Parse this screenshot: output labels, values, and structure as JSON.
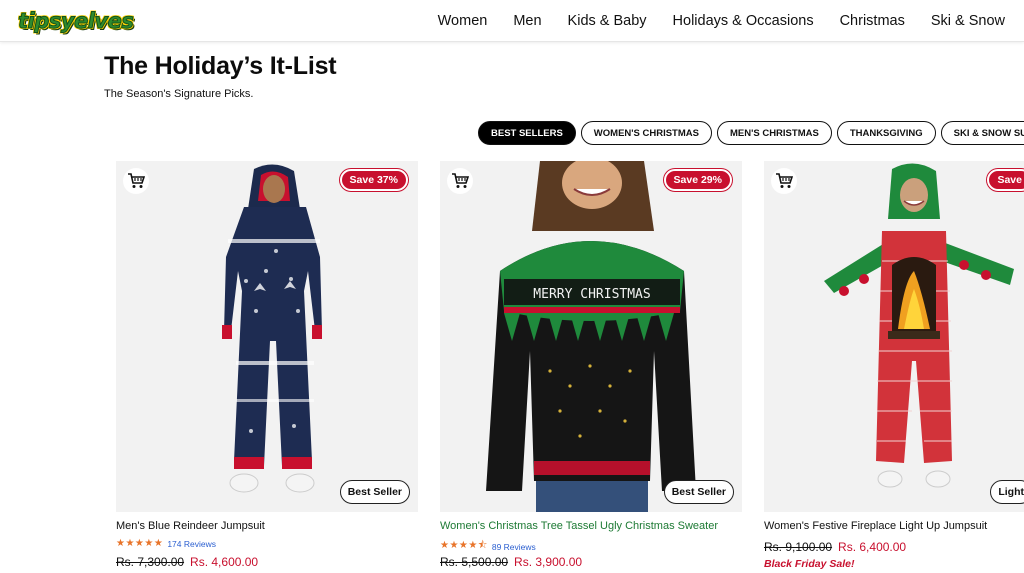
{
  "header": {
    "logo_text": "tipsyelves",
    "nav": [
      "Women",
      "Men",
      "Kids & Baby",
      "Holidays & Occasions",
      "Christmas",
      "Ski & Snow"
    ]
  },
  "section": {
    "title": "The Holiday’s It-List",
    "subtitle": "The Season's Signature Picks."
  },
  "tabs": [
    {
      "label": "BEST SELLERS",
      "active": true
    },
    {
      "label": "WOMEN'S CHRISTMAS",
      "active": false
    },
    {
      "label": "MEN'S CHRISTMAS",
      "active": false
    },
    {
      "label": "THANKSGIVING",
      "active": false
    },
    {
      "label": "SKI & SNOW SUITS",
      "active": false
    }
  ],
  "products": [
    {
      "name": "Men's Blue Reindeer Jumpsuit",
      "save": "Save 37%",
      "badge": "Best Seller",
      "stars": "★★★★★",
      "reviews": "174 Reviews",
      "price_old": "Rs. 7,300.00",
      "price_new": "Rs. 4,600.00"
    },
    {
      "name": "Women's Christmas Tree Tassel Ugly Christmas Sweater",
      "save": "Save 29%",
      "badge": "Best Seller",
      "stars": "★★★★⯪",
      "reviews": "89 Reviews",
      "price_old": "Rs. 5,500.00",
      "price_new": "Rs. 3,900.00",
      "sweater_text": "MERRY CHRISTMAS"
    },
    {
      "name": "Women's Festive Fireplace Light Up Jumpsuit",
      "save": "Save",
      "badge": "Light",
      "price_old": "Rs. 9,100.00",
      "price_new": "Rs. 6,400.00",
      "promo": "Black Friday Sale!"
    }
  ],
  "colors": {
    "accent_red": "#c8102e",
    "review_blue": "#2b5fd0",
    "star_orange": "#e8742a",
    "name_green": "#1d7a34"
  },
  "icons": [
    "cart-icon"
  ]
}
